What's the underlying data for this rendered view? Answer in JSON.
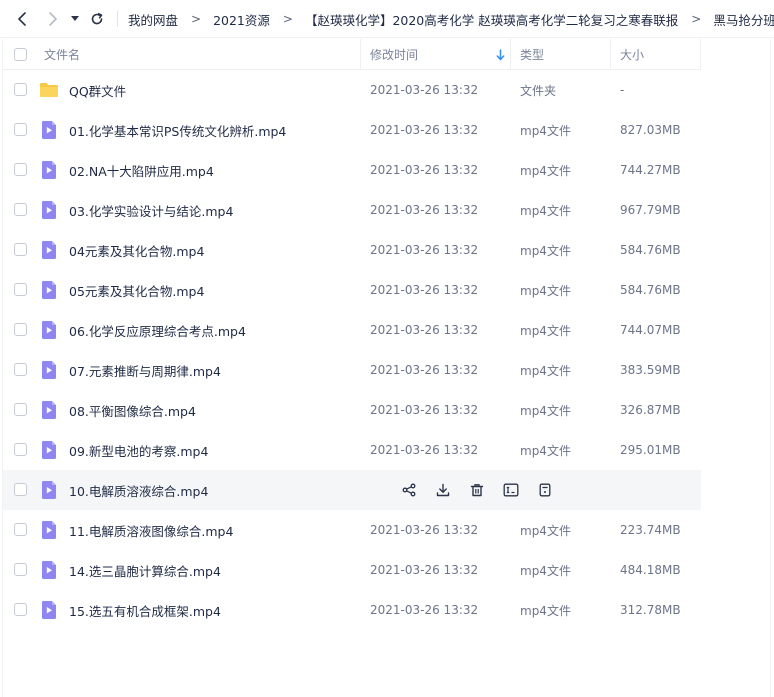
{
  "breadcrumb": {
    "items": [
      "我的网盘",
      "2021资源",
      "【赵瑛瑛化学】2020高考化学 赵瑛瑛高考化学二轮复习之寒春联报",
      "黑马抢分班"
    ],
    "separator": ">"
  },
  "table": {
    "headers": {
      "name": "文件名",
      "modified": "修改时间",
      "type": "类型",
      "size": "大小"
    },
    "sort_column": "modified",
    "rows": [
      {
        "kind": "folder",
        "name": "QQ群文件",
        "modified": "2021-03-26 13:32",
        "type": "文件夹",
        "size": "-"
      },
      {
        "kind": "video",
        "name": "01.化学基本常识PS传统文化辨析.mp4",
        "modified": "2021-03-26 13:32",
        "type": "mp4文件",
        "size": "827.03MB"
      },
      {
        "kind": "video",
        "name": "02.NA十大陷阱应用.mp4",
        "modified": "2021-03-26 13:32",
        "type": "mp4文件",
        "size": "744.27MB"
      },
      {
        "kind": "video",
        "name": "03.化学实验设计与结论.mp4",
        "modified": "2021-03-26 13:32",
        "type": "mp4文件",
        "size": "967.79MB"
      },
      {
        "kind": "video",
        "name": "04元素及其化合物.mp4",
        "modified": "2021-03-26 13:32",
        "type": "mp4文件",
        "size": "584.76MB"
      },
      {
        "kind": "video",
        "name": "05元素及其化合物.mp4",
        "modified": "2021-03-26 13:32",
        "type": "mp4文件",
        "size": "584.76MB"
      },
      {
        "kind": "video",
        "name": "06.化学反应原理综合考点.mp4",
        "modified": "2021-03-26 13:32",
        "type": "mp4文件",
        "size": "744.07MB"
      },
      {
        "kind": "video",
        "name": "07.元素推断与周期律.mp4",
        "modified": "2021-03-26 13:32",
        "type": "mp4文件",
        "size": "383.59MB"
      },
      {
        "kind": "video",
        "name": "08.平衡图像综合.mp4",
        "modified": "2021-03-26 13:32",
        "type": "mp4文件",
        "size": "326.87MB"
      },
      {
        "kind": "video",
        "name": "09.新型电池的考察.mp4",
        "modified": "2021-03-26 13:32",
        "type": "mp4文件",
        "size": "295.01MB"
      },
      {
        "kind": "video",
        "name": "10.电解质溶液综合.mp4",
        "modified": "",
        "type": "",
        "size": "",
        "hovered": true
      },
      {
        "kind": "video",
        "name": "11.电解质溶液图像综合.mp4",
        "modified": "2021-03-26 13:32",
        "type": "mp4文件",
        "size": "223.74MB"
      },
      {
        "kind": "video",
        "name": "14.选三晶胞计算综合.mp4",
        "modified": "2021-03-26 13:32",
        "type": "mp4文件",
        "size": "484.18MB"
      },
      {
        "kind": "video",
        "name": "15.选五有机合成框架.mp4",
        "modified": "2021-03-26 13:32",
        "type": "mp4文件",
        "size": "312.78MB"
      }
    ]
  },
  "row_actions": [
    "share-icon",
    "download-icon",
    "delete-icon",
    "rename-icon",
    "more-icon"
  ],
  "colors": {
    "folder": "#f7c843",
    "video": "#8f86f2",
    "sort_arrow": "#2f8cf7",
    "text_primary": "#1f2a44",
    "text_secondary": "#6b7488",
    "hover_row": "#f5f6f8"
  }
}
